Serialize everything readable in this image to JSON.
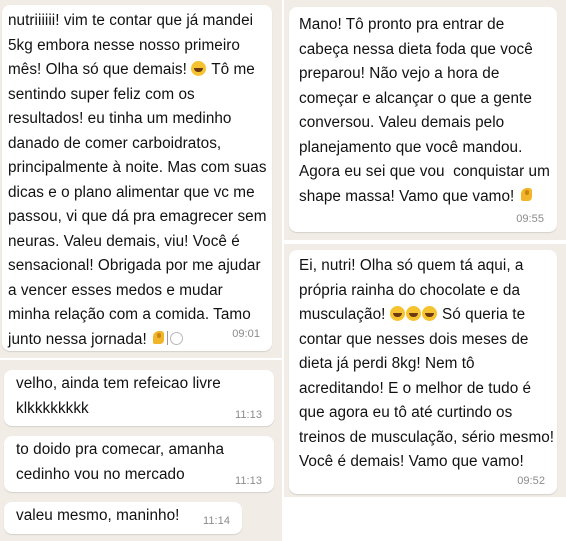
{
  "messages": [
    {
      "lines": [
        "nutriiiiii! vim te contar que já mandei",
        "5kg embora nesse nosso primeiro",
        "mês! Olha só que demais! {face} Tô me",
        "sentindo super feliz com os",
        "resultados! eu tinha um medinho",
        "danado de comer carboidratos,",
        "principalmente à noite. Mas com suas",
        "dicas e o plano alimentar que vc me",
        "passou, vi que dá pra emagrecer sem",
        "neuras. Valeu demais, viu! Você é",
        "sensacional! Obrigada por me ajudar",
        "a vencer esses medos e mudar",
        "minha relação com a comida. Tamo",
        "junto nessa jornada! {flex}{plate}"
      ],
      "time": "09:01"
    },
    {
      "lines": [
        "velho, ainda tem refeicao livre",
        "klkkkkkkkk"
      ],
      "time": "11:13"
    },
    {
      "lines": [
        "to doido pra comecar, amanha",
        "cedinho vou no mercado"
      ],
      "time": "11:13"
    },
    {
      "lines": [
        "valeu mesmo, maninho!"
      ],
      "time": "11:14"
    },
    {
      "lines": [
        "Mano! Tô pronto pra entrar de",
        "cabeça nessa dieta foda que você",
        "preparou! Não vejo a hora de",
        "começar e alcançar o que a gente",
        "conversou. Valeu demais pelo",
        "planejamento que você mandou.",
        "Agora eu sei que vou  conquistar um",
        "shape massa! Vamo que vamo! {flex}"
      ],
      "time": "09:55"
    },
    {
      "lines": [
        "Ei, nutri! Olha só quem tá aqui, a",
        "própria rainha do chocolate e da",
        "musculação! {face}{face}{face} Só queria te",
        "contar que nesses dois meses de",
        "dieta já perdi 8kg! Nem tô",
        "acreditando! E o melhor de tudo é",
        "que agora eu tô até curtindo os",
        "treinos de musculação, sério mesmo!",
        "Você é demais! Vamo que vamo!"
      ],
      "time": "09:52"
    }
  ],
  "emoji": {
    "face": "laughing-face-icon",
    "flex": "flexed-biceps-icon",
    "plate": "fork-knife-plate-icon"
  },
  "colors": {
    "panel_background": "#f1ece6",
    "bubble_background": "#ffffff",
    "timestamp": "#8b8b8b"
  }
}
